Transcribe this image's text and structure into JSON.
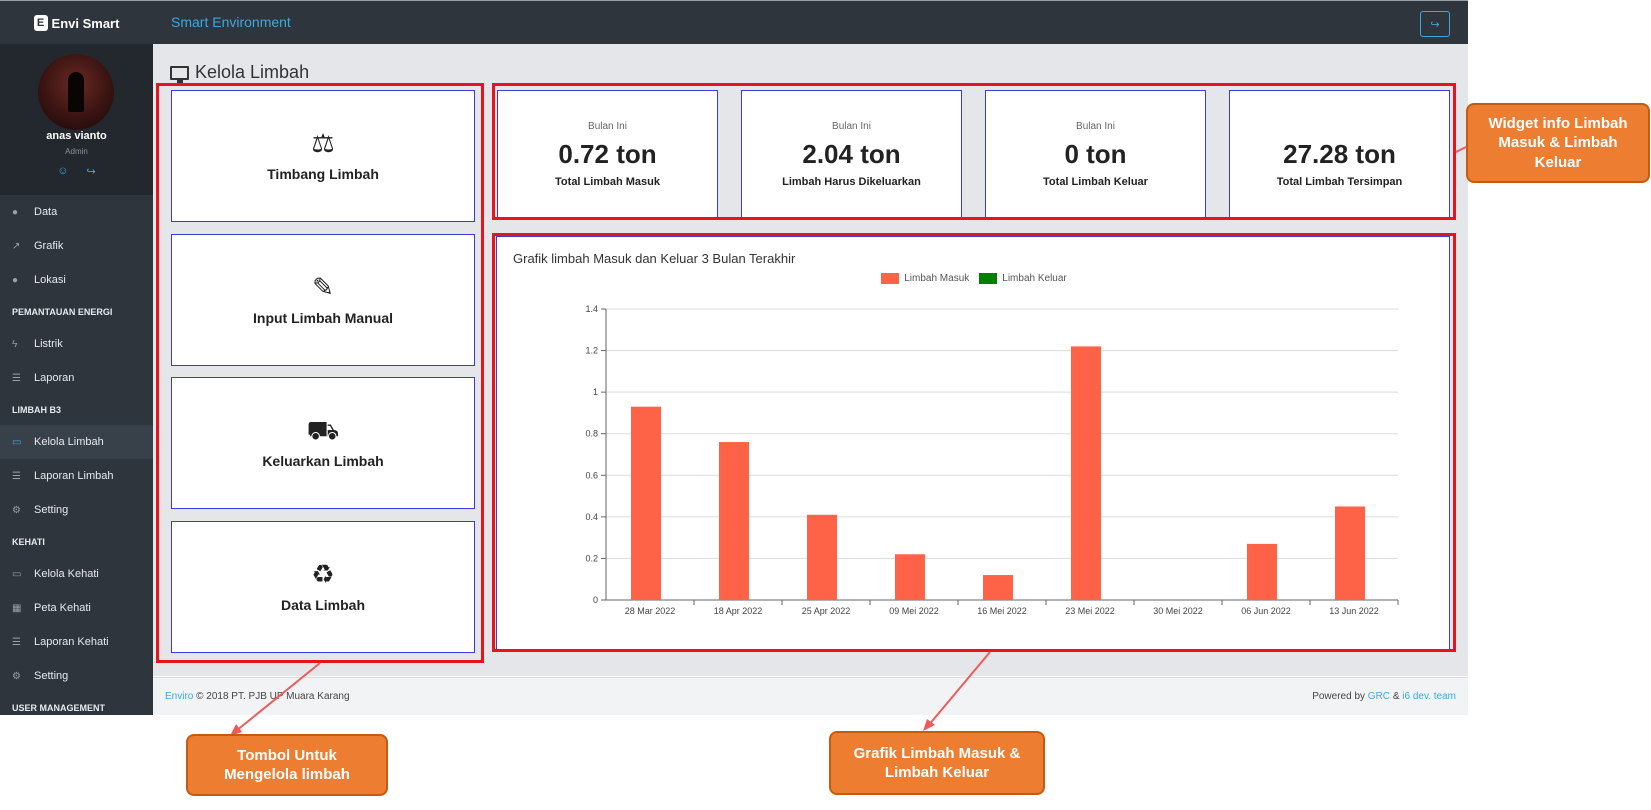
{
  "header": {
    "brand": "Envi Smart",
    "brand_badge": "E",
    "app_title": "Smart Environment",
    "logout_icon": "sign-out-icon"
  },
  "profile": {
    "name": "anas vianto",
    "role": "Admin",
    "icons": [
      "user-icon",
      "sign-out-icon"
    ]
  },
  "sidebar": {
    "items": [
      {
        "label": "Data",
        "icon": "tint-icon",
        "glyph": "●"
      },
      {
        "label": "Grafik",
        "icon": "line-chart-icon",
        "glyph": "↗"
      },
      {
        "label": "Lokasi",
        "icon": "map-marker-icon",
        "glyph": "●"
      }
    ],
    "section_energi": "PEMANTAUAN ENERGI",
    "energi_items": [
      {
        "label": "Listrik",
        "icon": "bolt-icon",
        "glyph": "ϟ"
      },
      {
        "label": "Laporan",
        "icon": "file-icon",
        "glyph": "☰"
      }
    ],
    "section_limbah": "LIMBAH B3",
    "limbah_items": [
      {
        "label": "Kelola Limbah",
        "icon": "desktop-icon",
        "glyph": "▭",
        "active": true
      },
      {
        "label": "Laporan Limbah",
        "icon": "file-icon",
        "glyph": "☰"
      },
      {
        "label": "Setting",
        "icon": "gear-icon",
        "glyph": "⚙"
      }
    ],
    "section_kehati": "KEHATI",
    "kehati_items": [
      {
        "label": "Kelola Kehati",
        "icon": "desktop-icon",
        "glyph": "▭"
      },
      {
        "label": "Peta Kehati",
        "icon": "map-icon",
        "glyph": "▦"
      },
      {
        "label": "Laporan Kehati",
        "icon": "file-icon",
        "glyph": "☰"
      },
      {
        "label": "Setting",
        "icon": "gear-icon",
        "glyph": "⚙"
      }
    ],
    "section_user": "USER MANAGEMENT"
  },
  "page": {
    "title": "Kelola Limbah",
    "title_icon": "desktop-icon"
  },
  "actions": [
    {
      "label": "Timbang Limbah",
      "icon": "balance-scale-icon",
      "glyph": "⚖"
    },
    {
      "label": "Input Limbah Manual",
      "icon": "edit-icon",
      "glyph": "✎"
    },
    {
      "label": "Keluarkan Limbah",
      "icon": "truck-icon",
      "glyph": "⛟"
    },
    {
      "label": "Data Limbah",
      "icon": "recycle-icon",
      "glyph": "♻"
    }
  ],
  "stats": [
    {
      "sub": "Bulan Ini",
      "value": "0.72 ton",
      "caption": "Total Limbah Masuk"
    },
    {
      "sub": "Bulan Ini",
      "value": "2.04 ton",
      "caption": "Limbah Harus Dikeluarkan"
    },
    {
      "sub": "Bulan Ini",
      "value": "0 ton",
      "caption": "Total Limbah Keluar"
    },
    {
      "sub": "",
      "value": "27.28 ton",
      "caption": "Total Limbah Tersimpan"
    }
  ],
  "chart_data": {
    "type": "bar",
    "title": "Grafik limbah Masuk dan Keluar 3 Bulan Terakhir",
    "categories": [
      "28 Mar 2022",
      "18 Apr 2022",
      "25 Apr 2022",
      "09 Mei 2022",
      "16 Mei 2022",
      "23 Mei 2022",
      "30 Mei 2022",
      "06 Jun 2022",
      "13 Jun 2022"
    ],
    "series": [
      {
        "name": "Limbah Masuk",
        "color": "#ff6347",
        "values": [
          0.93,
          0.76,
          0.41,
          0.22,
          0.12,
          1.22,
          0,
          0.27,
          0.45
        ]
      },
      {
        "name": "Limbah Keluar",
        "color": "#008000",
        "values": [
          0,
          0,
          0,
          0,
          0,
          0,
          0,
          0,
          0
        ]
      }
    ],
    "ylim": [
      0,
      1.4
    ],
    "yticks": [
      "0",
      "0.2",
      "0.4",
      "0.6",
      "0.8",
      "1",
      "1.2",
      "1.4"
    ],
    "grid": true,
    "legend": "top-center"
  },
  "footer": {
    "brand_link": "Enviro",
    "copyright": "© 2018 PT. PJB UP Muara Karang",
    "powered_by": "Powered by",
    "link_grc": "GRC",
    "amp": "&",
    "link_team": "i6 dev. team"
  },
  "callouts": {
    "widget": "Widget info Limbah Masuk & Limbah Keluar",
    "tombol": "Tombol Untuk Mengelola limbah",
    "grafik": "Grafik Limbah Masuk & Limbah Keluar"
  },
  "colors": {
    "accent": "#3fa7e0",
    "sidebar": "#2e353d",
    "highlight": "#e8141c",
    "callout": "#ed7d31"
  }
}
